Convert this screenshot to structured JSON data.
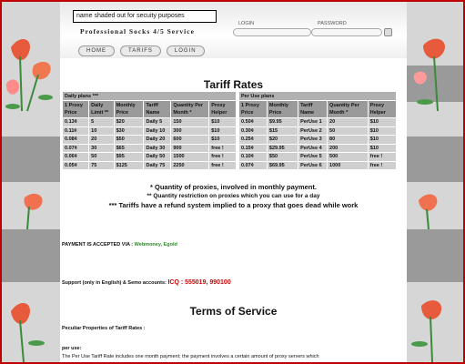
{
  "header": {
    "notice": "name shaded out for secuity purposes",
    "brand": "Professional Socks 4/5 Service",
    "login_label": "LOGIN",
    "password_label": "PASSWORD"
  },
  "nav": [
    "HOME",
    "TARIFS",
    "LOGIN"
  ],
  "main": {
    "title": "Tariff Rates",
    "daily": {
      "caption": "Daily plans ***",
      "headers": [
        "1 Proxy Price",
        "Daily Limit **",
        "Monthly Price",
        "Tariff Name",
        "Quantity Per Month *",
        "Proxy Helper"
      ],
      "rows": [
        [
          "0.13¢",
          "5",
          "$20",
          "Daily 5",
          "150",
          "$10"
        ],
        [
          "0.11¢",
          "10",
          "$30",
          "Daily 10",
          "300",
          "$10"
        ],
        [
          "0.08¢",
          "20",
          "$50",
          "Daily 20",
          "600",
          "$10"
        ],
        [
          "0.07¢",
          "30",
          "$65",
          "Daily 30",
          "900",
          "free !"
        ],
        [
          "0.06¢",
          "50",
          "$95",
          "Daily 50",
          "1500",
          "free !"
        ],
        [
          "0.05¢",
          "75",
          "$125",
          "Daily 75",
          "2250",
          "free !"
        ]
      ]
    },
    "peruse": {
      "caption": "Per Use plans",
      "headers": [
        "1 Proxy Price",
        "Monthly Price",
        "Tariff Name",
        "Quantity Per Month *",
        "Proxy Helper"
      ],
      "rows": [
        [
          "0.50¢",
          "$9.95",
          "PerUse 1",
          "20",
          "$10"
        ],
        [
          "0.30¢",
          "$15",
          "PerUse 2",
          "50",
          "$10"
        ],
        [
          "0.25¢",
          "$20",
          "PerUse 3",
          "80",
          "$10"
        ],
        [
          "0.15¢",
          "$29.95",
          "PerUse 4",
          "200",
          "$10"
        ],
        [
          "0.10¢",
          "$50",
          "PerUse 5",
          "500",
          "free !"
        ],
        [
          "0.07¢",
          "$69.95",
          "PerUse 6",
          "1000",
          "free !"
        ]
      ]
    },
    "notes": [
      "* Quantity of proxies, involved in monthly payment.",
      "** Quantity restriction on proxies which you can use for a day",
      "*** Tariffs have a refund system implied to a proxy that goes dead while work"
    ],
    "payment_label": "PAYMENT IS ACCEPTED VIA :",
    "payment_methods": "Webmoney, Egold",
    "support_label": "Support (only in English) &  Semo accounts:",
    "support_icq": "ICQ : 555019, 990100",
    "tos_title": "Terms of Service",
    "tos_sub": "Peculiar Properties of Tariff Rates :",
    "per_use": "per use:",
    "per_use_text": "The Per Use Tariff Rate includes one month payment; the payment involves a certain amount of proxy servers which"
  },
  "colors": {
    "frame": "#c00000",
    "table_header": "#9a9a9a",
    "table_cell": "#cfcfcf",
    "green": "#2a8a2a",
    "icq": "#d00000"
  }
}
